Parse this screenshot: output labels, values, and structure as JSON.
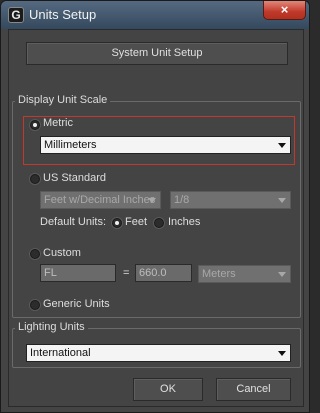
{
  "window": {
    "title": "Units Setup",
    "close_label": "×",
    "app_icon_glyph": "G"
  },
  "system_unit_setup_label": "System Unit Setup",
  "display_unit_scale": {
    "label": "Display Unit Scale",
    "metric": {
      "label": "Metric",
      "selected": true,
      "value": "Millimeters"
    },
    "us_standard": {
      "label": "US Standard",
      "unit_value": "Feet w/Decimal Inches",
      "fraction_value": "1/8",
      "default_units_label": "Default Units:",
      "feet_label": "Feet",
      "inches_label": "Inches"
    },
    "custom": {
      "label": "Custom",
      "name_value": "FL",
      "equals": "=",
      "amount_value": "660.0",
      "unit_value": "Meters"
    },
    "generic": {
      "label": "Generic Units"
    }
  },
  "lighting_units": {
    "label": "Lighting Units",
    "value": "International"
  },
  "buttons": {
    "ok": "OK",
    "cancel": "Cancel"
  },
  "colors": {
    "highlight": "#c0392b",
    "titlebar": "#3f5368",
    "panel": "#444444"
  }
}
